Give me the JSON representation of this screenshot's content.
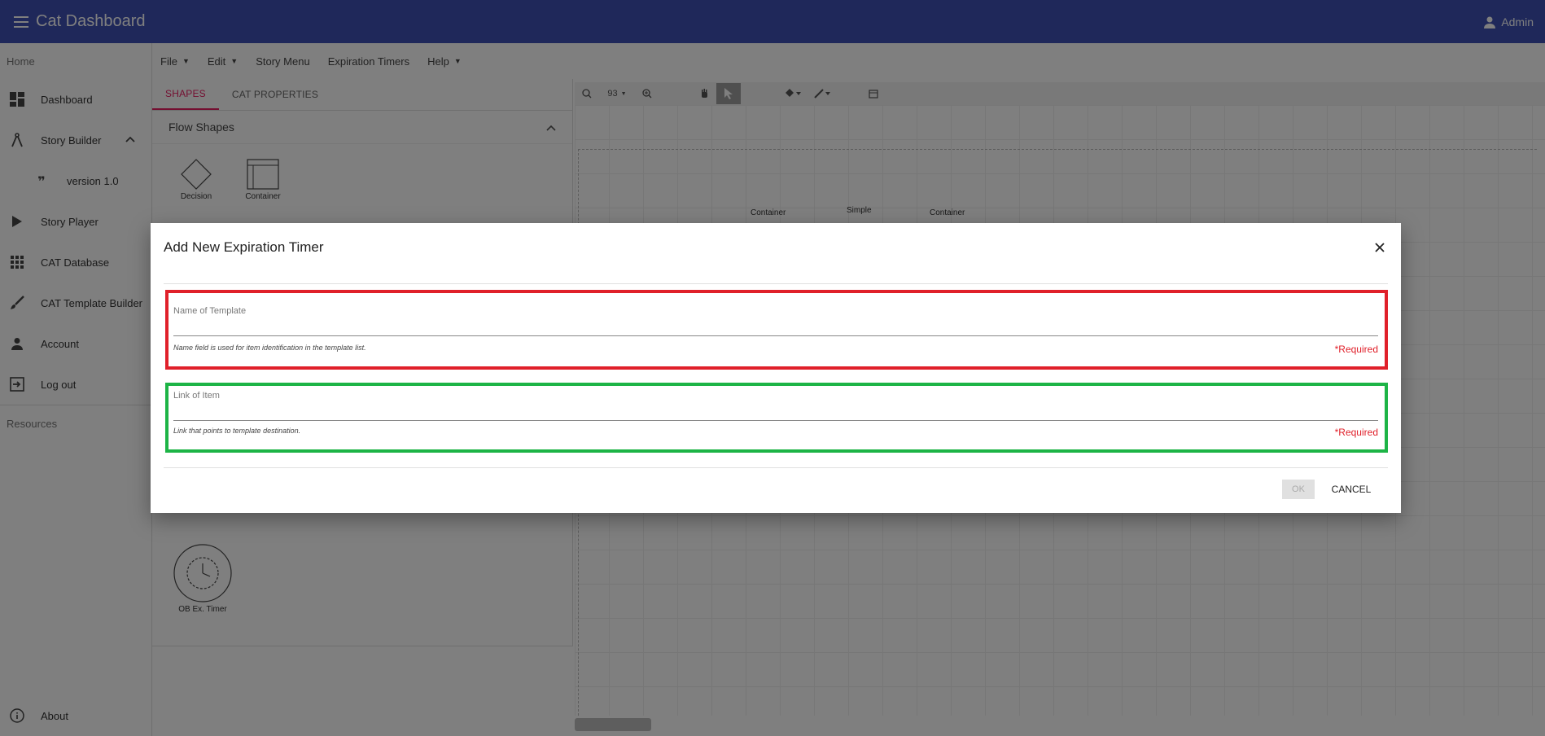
{
  "app": {
    "title": "Cat Dashboard",
    "user": "Admin"
  },
  "sidebar": {
    "home_label": "Home",
    "resources_label": "Resources",
    "items": [
      {
        "label": "Dashboard",
        "icon": "dashboard-icon"
      },
      {
        "label": "Story Builder",
        "icon": "compass-icon"
      },
      {
        "label": "version 1.0",
        "icon": "quote-icon"
      },
      {
        "label": "Story Player",
        "icon": "play-icon"
      },
      {
        "label": "CAT Database",
        "icon": "apps-grid-icon"
      },
      {
        "label": "CAT Template Builder",
        "icon": "brush-icon"
      },
      {
        "label": "Account",
        "icon": "person-icon"
      },
      {
        "label": "Log out",
        "icon": "logout-icon"
      }
    ],
    "about_label": "About"
  },
  "menubar": {
    "file": "File",
    "edit": "Edit",
    "story_menu": "Story Menu",
    "expiration_timers": "Expiration Timers",
    "help": "Help"
  },
  "panel": {
    "tabs": [
      "SHAPES",
      "CAT PROPERTIES"
    ],
    "section_title": "Flow Shapes",
    "shapes": [
      "Decision",
      "Container",
      "OB Ex. Timer"
    ]
  },
  "canvas": {
    "zoom": "93",
    "labels": [
      "Container",
      "Simple",
      "Container"
    ]
  },
  "dialog": {
    "title": "Add New Expiration Timer",
    "fields": [
      {
        "label": "Name of Template",
        "value": "",
        "help": "Name field is used for item identification in the template list.",
        "required": "*Required"
      },
      {
        "label": "Link of Item",
        "value": "",
        "help": "Link that points to template destination.",
        "required": "*Required"
      }
    ],
    "ok_label": "OK",
    "cancel_label": "CANCEL"
  },
  "colors": {
    "appbar": "#3f51b5",
    "accent": "#e91e63",
    "field_highlight_1": "#e0202a",
    "field_highlight_2": "#1db446",
    "required": "#e0202a"
  }
}
